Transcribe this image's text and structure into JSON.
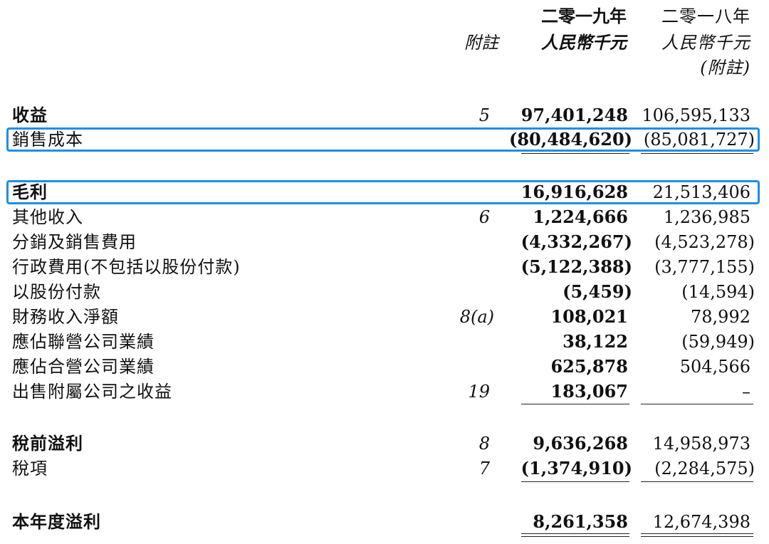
{
  "header": {
    "year2019": "二零一九年",
    "year2018": "二零一八年",
    "note": "附註",
    "currency2019": "人民幣千元",
    "currency2018": "人民幣千元",
    "note2018": "(附註)"
  },
  "rows": [
    {
      "label": "收益",
      "note": "5",
      "v2019": "97,401,248",
      "v2018": "106,595,133"
    },
    {
      "label": "銷售成本",
      "note": "",
      "v2019": "(80,484,620)",
      "v2018": "(85,081,727)"
    },
    {
      "label": "毛利",
      "note": "",
      "v2019": "16,916,628",
      "v2018": "21,513,406"
    },
    {
      "label": "其他收入",
      "note": "6",
      "v2019": "1,224,666",
      "v2018": "1,236,985"
    },
    {
      "label": "分銷及銷售費用",
      "note": "",
      "v2019": "(4,332,267)",
      "v2018": "(4,523,278)"
    },
    {
      "label": "行政費用(不包括以股份付款)",
      "note": "",
      "v2019": "(5,122,388)",
      "v2018": "(3,777,155)"
    },
    {
      "label": "以股份付款",
      "note": "",
      "v2019": "(5,459)",
      "v2018": "(14,594)"
    },
    {
      "label": "財務收入淨額",
      "note": "8(a)",
      "v2019": "108,021",
      "v2018": "78,992"
    },
    {
      "label": "應佔聯營公司業績",
      "note": "",
      "v2019": "38,122",
      "v2018": "(59,949)"
    },
    {
      "label": "應佔合營公司業績",
      "note": "",
      "v2019": "625,878",
      "v2018": "504,566"
    },
    {
      "label": "出售附屬公司之收益",
      "note": "19",
      "v2019": "183,067",
      "v2018": "–"
    },
    {
      "label": "稅前溢利",
      "note": "8",
      "v2019": "9,636,268",
      "v2018": "14,958,973"
    },
    {
      "label": "稅項",
      "note": "7",
      "v2019": "(1,374,910)",
      "v2018": "(2,284,575)"
    },
    {
      "label": "本年度溢利",
      "note": "",
      "v2019": "8,261,358",
      "v2018": "12,674,398"
    }
  ]
}
